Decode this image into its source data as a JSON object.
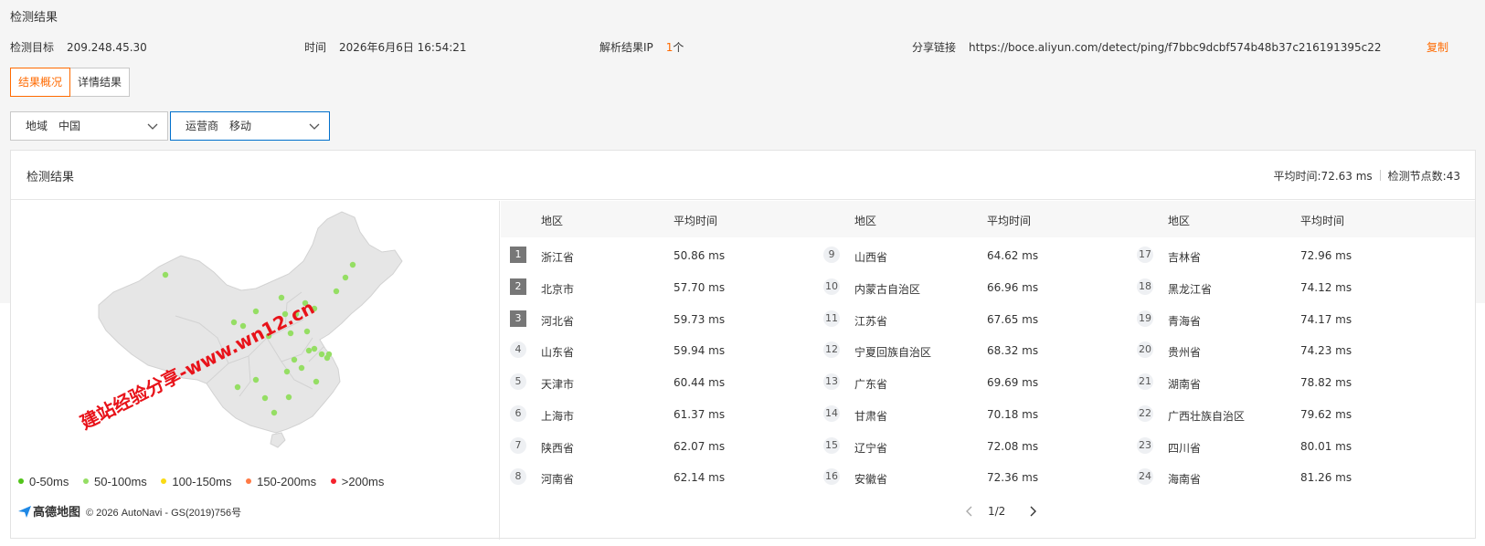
{
  "header": {
    "title": "检测结果",
    "target_label": "检测目标",
    "target_value": "209.248.45.30",
    "time_label": "时间",
    "time_value": "2026年6月6日 16:54:21",
    "ip_label": "解析结果IP",
    "ip_count": "1",
    "ip_unit": "个",
    "share_label": "分享链接",
    "share_url": "https://boce.aliyun.com/detect/ping/f7bbc9dcbf574b48b37c216191395c22",
    "copy_label": "复制"
  },
  "tabs": [
    {
      "label": "结果概况",
      "active": true
    },
    {
      "label": "详情结果",
      "active": false
    }
  ],
  "filters": {
    "region_label": "地域",
    "region_value": "中国",
    "isp_label": "运营商",
    "isp_value": "移动"
  },
  "panel": {
    "title": "检测结果",
    "avg_time": "平均时间:72.63 ms",
    "node_count": "检测节点数:43"
  },
  "legend": [
    {
      "label": "0-50ms",
      "color": "#52c41a"
    },
    {
      "label": "50-100ms",
      "color": "#95de64"
    },
    {
      "label": "100-150ms",
      "color": "#fadb14"
    },
    {
      "label": "150-200ms",
      "color": "#ff7a45"
    },
    {
      "label": ">200ms",
      "color": "#f5222d"
    }
  ],
  "attribution": {
    "logo": "高德地图",
    "text": "© 2026 AutoNavi - GS(2019)756号"
  },
  "watermark": "建站经验分享-www.wn12.cn",
  "table": {
    "col_region": "地区",
    "col_avg": "平均时间",
    "columns": [
      [
        {
          "rank": "1",
          "region": "浙江省",
          "avg": "50.86 ms"
        },
        {
          "rank": "2",
          "region": "北京市",
          "avg": "57.70 ms"
        },
        {
          "rank": "3",
          "region": "河北省",
          "avg": "59.73 ms"
        },
        {
          "rank": "4",
          "region": "山东省",
          "avg": "59.94 ms"
        },
        {
          "rank": "5",
          "region": "天津市",
          "avg": "60.44 ms"
        },
        {
          "rank": "6",
          "region": "上海市",
          "avg": "61.37 ms"
        },
        {
          "rank": "7",
          "region": "陕西省",
          "avg": "62.07 ms"
        },
        {
          "rank": "8",
          "region": "河南省",
          "avg": "62.14 ms"
        }
      ],
      [
        {
          "rank": "9",
          "region": "山西省",
          "avg": "64.62 ms"
        },
        {
          "rank": "10",
          "region": "内蒙古自治区",
          "avg": "66.96 ms"
        },
        {
          "rank": "11",
          "region": "江苏省",
          "avg": "67.65 ms"
        },
        {
          "rank": "12",
          "region": "宁夏回族自治区",
          "avg": "68.32 ms"
        },
        {
          "rank": "13",
          "region": "广东省",
          "avg": "69.69 ms"
        },
        {
          "rank": "14",
          "region": "甘肃省",
          "avg": "70.18 ms"
        },
        {
          "rank": "15",
          "region": "辽宁省",
          "avg": "72.08 ms"
        },
        {
          "rank": "16",
          "region": "安徽省",
          "avg": "72.36 ms"
        }
      ],
      [
        {
          "rank": "17",
          "region": "吉林省",
          "avg": "72.96 ms"
        },
        {
          "rank": "18",
          "region": "黑龙江省",
          "avg": "74.12 ms"
        },
        {
          "rank": "19",
          "region": "青海省",
          "avg": "74.17 ms"
        },
        {
          "rank": "20",
          "region": "贵州省",
          "avg": "74.23 ms"
        },
        {
          "rank": "21",
          "region": "湖南省",
          "avg": "78.82 ms"
        },
        {
          "rank": "22",
          "region": "广西壮族自治区",
          "avg": "79.62 ms"
        },
        {
          "rank": "23",
          "region": "四川省",
          "avg": "80.01 ms"
        },
        {
          "rank": "24",
          "region": "海南省",
          "avg": "81.26 ms"
        }
      ]
    ],
    "page": "1/2"
  },
  "map_dot_color": "#95de64"
}
